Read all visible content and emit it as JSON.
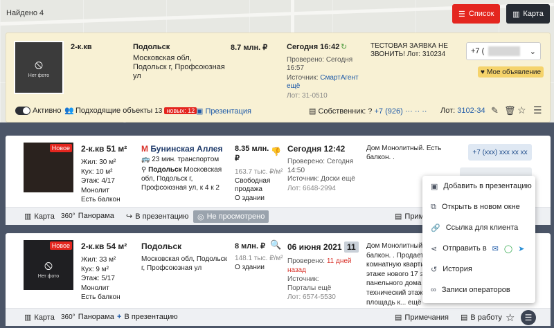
{
  "header": {
    "found": "Найдено 4",
    "list_label": "Список",
    "map_label": "Карта"
  },
  "top": {
    "photo_label": "Нет фото",
    "type": "2-к.кв",
    "city": "Подольск",
    "address": "Московская обл, Подольск г, Профсоюзная ул",
    "price": "8.7 млн. ₽",
    "date": "Сегодня 16:42",
    "checked": "Проверено: Сегодня 16:57",
    "source_prefix": "Источник:",
    "source": "СмартАгент",
    "source_more": "ещё",
    "lot": "Лот: 31-0510",
    "note": "ТЕСТОВАЯ ЗАЯВКА НЕ ЗВОНИТЬ! Лот: 310234",
    "phone_prefix": "+7 (",
    "my_object": "Мое объявление",
    "active": "Активно",
    "matching_label": "Подходящие объекты",
    "matching_count": "13",
    "new_badge": "новых: 12",
    "presentation": "Презентация",
    "owner_label": "Собственник: ?",
    "owner_phone": "+7 (926) ··· ·· ··",
    "lot_code_label": "Лот:",
    "lot_code": "3102-34"
  },
  "card1": {
    "new": "Новое",
    "type": "2-к.кв 51 м²",
    "living": "Жил: 30 м²",
    "kitchen": "Кух: 10 м²",
    "floor": "Этаж: 4/17",
    "material": "Монолит",
    "balcony": "Есть балкон",
    "metro": "Бунинская Аллея",
    "metro_time": "23 мин. транспортом",
    "city": "Подольск",
    "address_tail": "Московская обл, Подольск г, Профсоюзная ул, к 4 к 2",
    "price": "8.35 млн. ₽",
    "price_sqm": "163.7 тыс. ₽/м²",
    "sale_type": "Свободная продажа",
    "about": "О здании",
    "date": "Сегодня 12:42",
    "checked": "Проверено: Сегодня 14:50",
    "source": "Источник: Доски ещё",
    "lot": "Лот: 6648-2994",
    "desc": "Дом Монолитный. Есть балкон. .",
    "contact": "+7 (xxx) xxx xx xx",
    "footer": {
      "map": "Карта",
      "panorama": "Панорама",
      "to_presentation": "В презентацию",
      "not_viewed": "Не просмотрено",
      "notes": "Приме"
    }
  },
  "card2": {
    "new": "Новое",
    "photo_label": "Нет фото",
    "type": "2-к.кв 54 м²",
    "living": "Жил: 33 м²",
    "kitchen": "Кух: 9 м²",
    "floor": "Этаж: 5/17",
    "material": "Монолит",
    "balcony": "Есть балкон",
    "city": "Подольск",
    "address": "Московская обл, Подольск г, Профсоюзная ул",
    "price": "8 млн. ₽",
    "price_sqm": "148.1 тыс. ₽/м²",
    "about": "О здании",
    "date": "06 июня 2021",
    "days": "11",
    "checked_prefix": "Проверено:",
    "checked_value": "11 дней назад",
    "source": "Источник: Порталы ещё",
    "lot": "Лот: 6574-5530",
    "desc_1": "Дом Монолитный. Есть",
    "desc_2": "балкон. . Продается",
    "desc_3": "комнатную квартир",
    "desc_4": "этаже нового 17 эт",
    "desc_5": "панельного дома в",
    "desc_6": "технический этаж",
    "desc_7": "площадь к... ещё",
    "footer": {
      "map": "Карта",
      "panorama": "Панорама",
      "to_presentation": "В презентацию",
      "notes": "Примечания",
      "to_work": "В работу"
    }
  },
  "menu": {
    "items": [
      "Добавить в презентацию",
      "Открыть в новом окне",
      "Ссылка для клиента",
      "Отправить в",
      "История",
      "Записи операторов"
    ]
  },
  "colors": {
    "accent_red": "#e4261f",
    "dark": "#262b33",
    "link": "#1e5aa8",
    "band": "#4b5567",
    "top_panel": "#f8f1d4"
  }
}
